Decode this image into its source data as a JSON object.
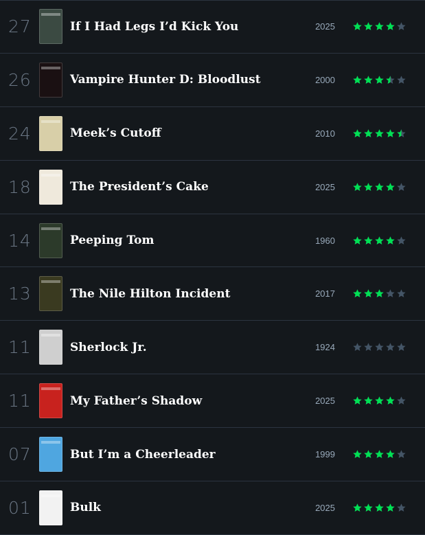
{
  "colors": {
    "background": "#14181c",
    "divider": "#2c3440",
    "rank": "#6b7785",
    "title": "#ffffff",
    "year": "#99aabb",
    "star_on": "#00e054",
    "star_off": "#445566"
  },
  "films": [
    {
      "rank": "27",
      "title": "If I Had Legs I’d Kick You",
      "year": "2025",
      "rating": 4,
      "poster_color": "#3b4a42"
    },
    {
      "rank": "26",
      "title": "Vampire Hunter D: Bloodlust",
      "year": "2000",
      "rating": 3.5,
      "poster_color": "#1a1012"
    },
    {
      "rank": "24",
      "title": "Meek’s Cutoff",
      "year": "2010",
      "rating": 4.5,
      "poster_color": "#d8cfa8"
    },
    {
      "rank": "18",
      "title": "The President’s Cake",
      "year": "2025",
      "rating": 4,
      "poster_color": "#efe9dc"
    },
    {
      "rank": "14",
      "title": "Peeping Tom",
      "year": "1960",
      "rating": 4,
      "poster_color": "#2c3a2a"
    },
    {
      "rank": "13",
      "title": "The Nile Hilton Incident",
      "year": "2017",
      "rating": 3,
      "poster_color": "#3a3a20"
    },
    {
      "rank": "11",
      "title": "Sherlock Jr.",
      "year": "1924",
      "rating": 0,
      "poster_color": "#cfcfcf"
    },
    {
      "rank": "11",
      "title": "My Father’s Shadow",
      "year": "2025",
      "rating": 4,
      "poster_color": "#c8221e"
    },
    {
      "rank": "07",
      "title": "But I’m a Cheerleader",
      "year": "1999",
      "rating": 4,
      "poster_color": "#4fa6e0"
    },
    {
      "rank": "01",
      "title": "Bulk",
      "year": "2025",
      "rating": 4,
      "poster_color": "#f2f2f2"
    }
  ]
}
